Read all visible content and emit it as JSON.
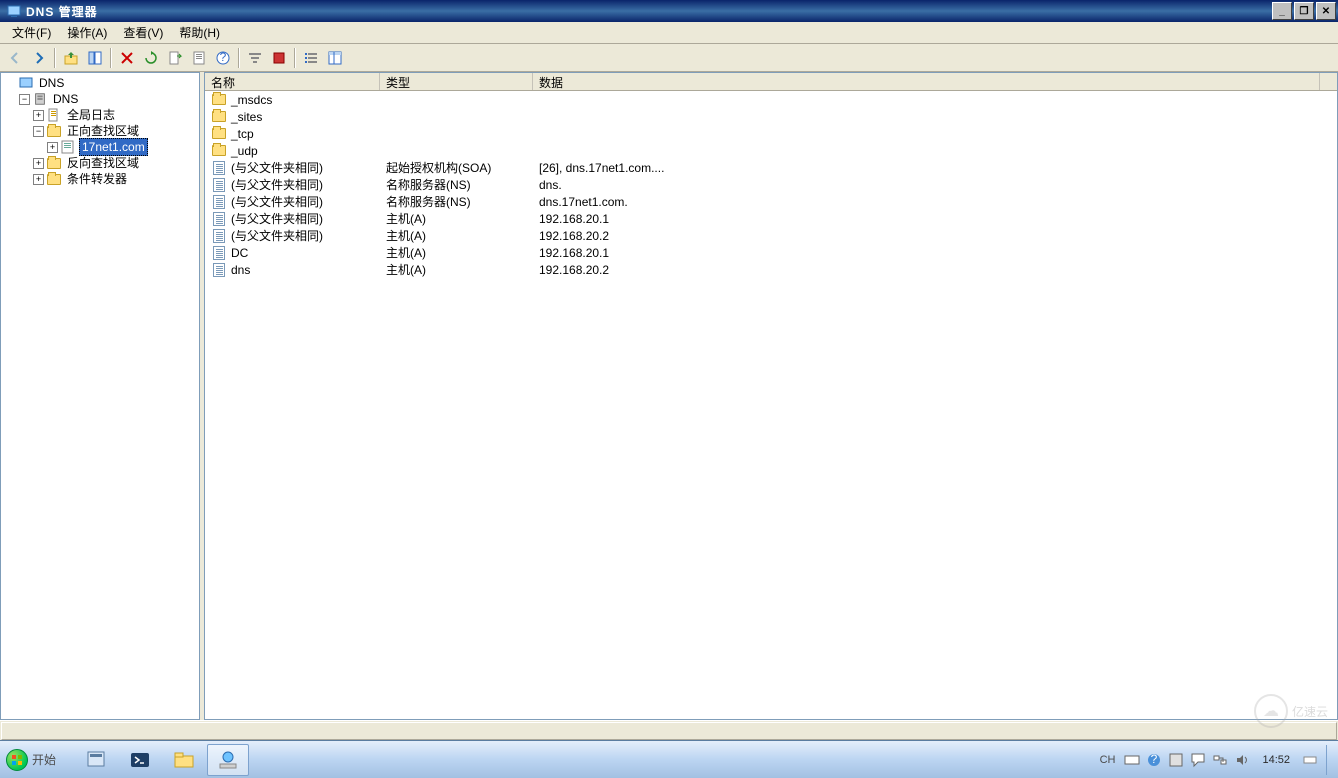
{
  "window": {
    "title": "DNS 管理器"
  },
  "menu": {
    "file": "文件(F)",
    "action": "操作(A)",
    "view": "查看(V)",
    "help": "帮助(H)"
  },
  "toolbar_icons": {
    "back": "back-icon",
    "forward": "forward-icon",
    "up": "up-icon",
    "show": "show-icon",
    "delete": "delete-icon",
    "props": "props-icon",
    "refresh": "refresh-icon",
    "export": "export-icon",
    "help": "help-icon",
    "filter1": "filter-icon",
    "filter2": "stop-icon",
    "list1": "list-icon",
    "list2": "detail-icon"
  },
  "tree": {
    "root": "DNS",
    "server": "DNS",
    "items": [
      {
        "label": "全局日志"
      },
      {
        "label": "正向查找区域",
        "children": [
          {
            "label": "17net1.com",
            "selected": true
          }
        ]
      },
      {
        "label": "反向查找区域"
      },
      {
        "label": "条件转发器"
      }
    ]
  },
  "columns": {
    "name": "名称",
    "type": "类型",
    "data": "数据"
  },
  "records": [
    {
      "icon": "folder",
      "name": "_msdcs",
      "type": "",
      "data": ""
    },
    {
      "icon": "folder",
      "name": "_sites",
      "type": "",
      "data": ""
    },
    {
      "icon": "folder",
      "name": "_tcp",
      "type": "",
      "data": ""
    },
    {
      "icon": "folder",
      "name": "_udp",
      "type": "",
      "data": ""
    },
    {
      "icon": "record",
      "name": "(与父文件夹相同)",
      "type": "起始授权机构(SOA)",
      "data": "[26], dns.17net1.com...."
    },
    {
      "icon": "record",
      "name": "(与父文件夹相同)",
      "type": "名称服务器(NS)",
      "data": "dns."
    },
    {
      "icon": "record",
      "name": "(与父文件夹相同)",
      "type": "名称服务器(NS)",
      "data": "dns.17net1.com."
    },
    {
      "icon": "record",
      "name": "(与父文件夹相同)",
      "type": "主机(A)",
      "data": "192.168.20.1"
    },
    {
      "icon": "record",
      "name": "(与父文件夹相同)",
      "type": "主机(A)",
      "data": "192.168.20.2"
    },
    {
      "icon": "record",
      "name": "DC",
      "type": "主机(A)",
      "data": "192.168.20.1"
    },
    {
      "icon": "record",
      "name": "dns",
      "type": "主机(A)",
      "data": "192.168.20.2"
    }
  ],
  "taskbar": {
    "start": "开始",
    "ime_lang": "CH",
    "time": "14:52"
  },
  "watermark": {
    "text": "亿速云"
  }
}
